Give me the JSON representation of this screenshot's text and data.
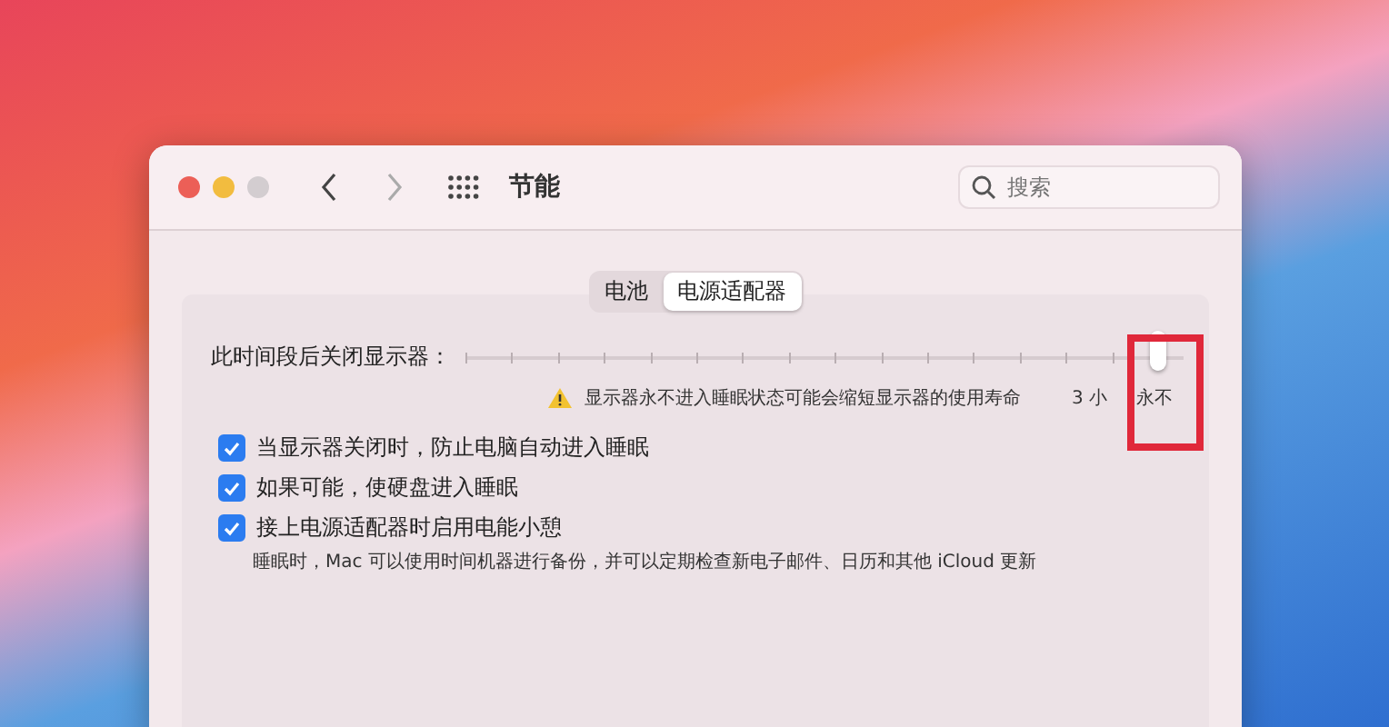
{
  "window": {
    "title": "节能",
    "search": {
      "placeholder": "搜索"
    }
  },
  "tabs": [
    {
      "label": "电池",
      "selected": false
    },
    {
      "label": "电源适配器",
      "selected": true
    }
  ],
  "display_sleep": {
    "label": "此时间段后关闭显示器：",
    "level": 1,
    "warning": "显示器永不进入睡眠状态可能会缩短显示器的使用寿命",
    "tick_labels": [
      "3 小",
      "永不"
    ],
    "highlighted": true
  },
  "options": [
    {
      "label": "当显示器关闭时，防止电脑自动进入睡眠",
      "checked": true
    },
    {
      "label": "如果可能，使硬盘进入睡眠",
      "checked": true
    },
    {
      "label": "接上电源适配器时启用电能小憩",
      "checked": true,
      "note": "睡眠时，Mac 可以使用时间机器进行备份，并可以定期检查新电子邮件、日历和其他 iCloud 更新"
    }
  ]
}
